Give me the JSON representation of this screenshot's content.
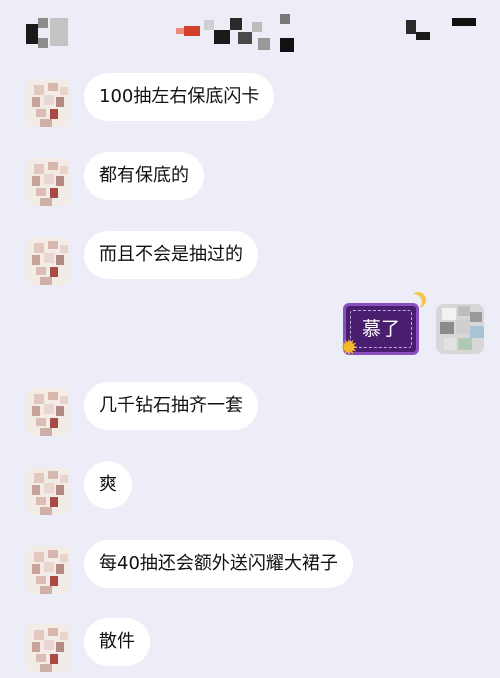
{
  "messages": [
    {
      "text": "100抽左右保底闪卡"
    },
    {
      "text": "都有保底的"
    },
    {
      "text": "而且不会是抽过的"
    },
    {
      "text": "慕了",
      "from_me": true
    },
    {
      "text": "几千钻石抽齐一套"
    },
    {
      "text": "爽"
    },
    {
      "text": "每40抽还会额外送闪耀大裙子"
    },
    {
      "text": "散件"
    }
  ],
  "colors": {
    "background": "#ededf7",
    "bubble": "#ffffff",
    "my_bubble": "#4a1e6e",
    "my_bubble_border": "#8a4fbf"
  }
}
